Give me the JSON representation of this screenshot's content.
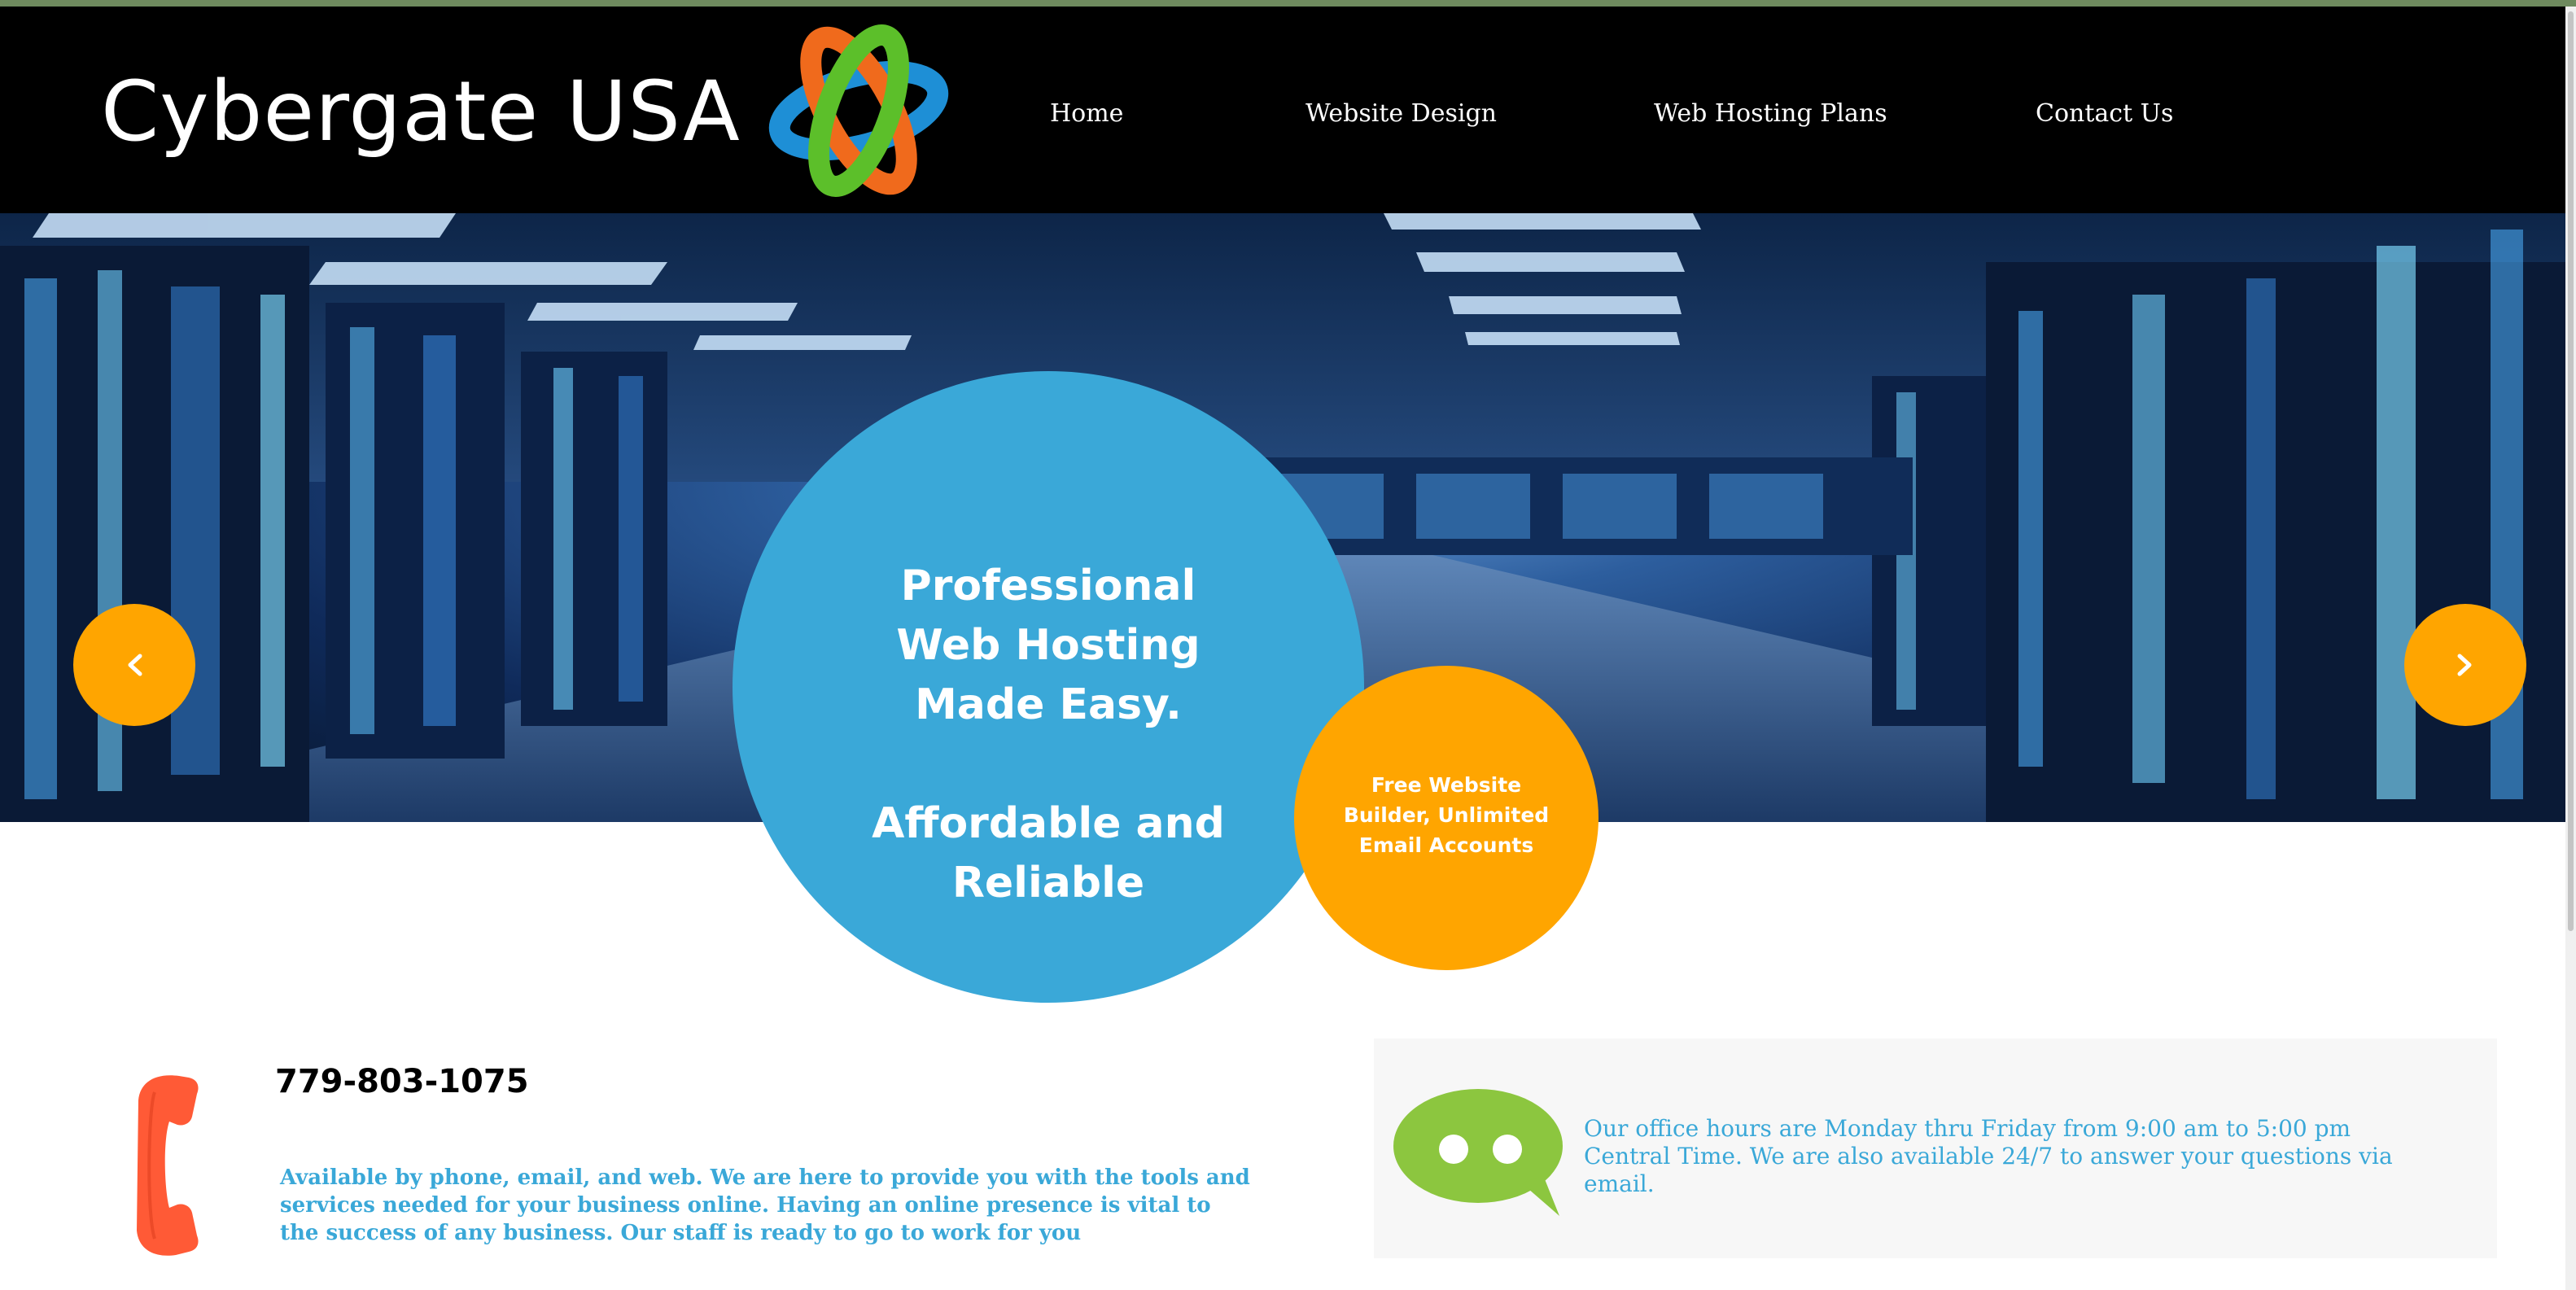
{
  "site": {
    "brand": "Cybergate USA"
  },
  "nav": {
    "items": [
      {
        "label": "Home"
      },
      {
        "label": "Website Design"
      },
      {
        "label": "Web Hosting Plans"
      },
      {
        "label": "Contact Us"
      }
    ]
  },
  "hero": {
    "headline_lines": [
      "Professional",
      "Web Hosting",
      "Made Easy."
    ],
    "tagline_lines": [
      "Affordable and",
      "Reliable"
    ],
    "badge_lines": [
      "Free Website",
      "Builder, Unlimited",
      "Email Accounts"
    ],
    "prev_icon": "chevron-left-icon",
    "next_icon": "chevron-right-icon"
  },
  "contact": {
    "phone": "779-803-1075",
    "phone_icon": "phone-icon",
    "description": "Available by phone, email, and web. We are here to provide you with the tools and services needed for your business online. Having an online presence is vital to the success of any business. Our staff is ready to go to work for you"
  },
  "hours": {
    "chat_icon": "chat-bubble-icon",
    "text": "Our office hours are Monday thru Friday from 9:00 am to 5:00 pm Central Time. We are also available 24/7 to answer your questions via email."
  },
  "colors": {
    "header_bg": "#000000",
    "accent_blue": "#3aa8d8",
    "accent_orange": "#ffa500",
    "phone_red": "#ff5a36",
    "chat_green": "#8cc63f"
  }
}
